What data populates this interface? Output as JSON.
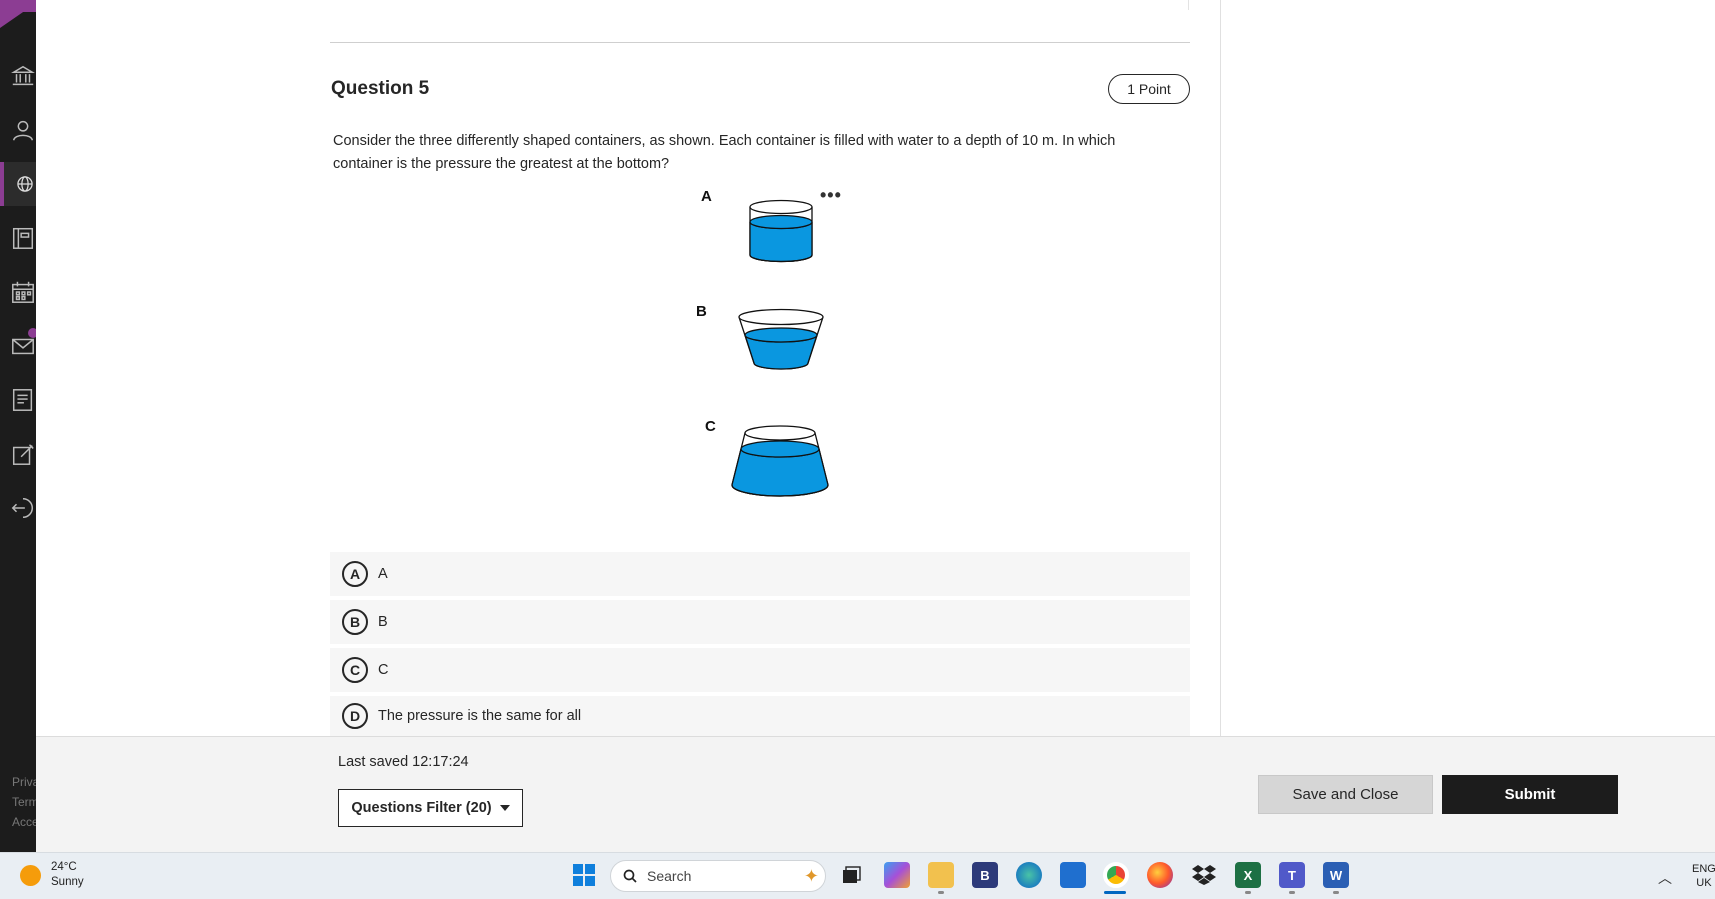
{
  "sidebar": {
    "nav": [
      {
        "name": "institution-icon"
      },
      {
        "name": "profile-icon"
      },
      {
        "name": "activity-globe-icon"
      },
      {
        "name": "courses-icon"
      },
      {
        "name": "calendar-icon"
      },
      {
        "name": "messages-icon"
      },
      {
        "name": "grades-icon"
      },
      {
        "name": "tools-icon"
      },
      {
        "name": "sign-out-icon"
      }
    ],
    "footer_links": [
      "Priva",
      "Term",
      "Acce"
    ]
  },
  "question": {
    "title": "Question 5",
    "points": "1 Point",
    "text": "Consider the three differently shaped containers, as shown. Each container is filled with water to a depth of 10 m. In which container is the pressure the greatest at the bottom?",
    "figure_labels": [
      "A",
      "B",
      "C"
    ],
    "more_menu": "•••",
    "water_color": "#0a97e0"
  },
  "options": [
    {
      "letter": "A",
      "text": "A"
    },
    {
      "letter": "B",
      "text": "B"
    },
    {
      "letter": "C",
      "text": "C"
    },
    {
      "letter": "D",
      "text": "The pressure is the same for all"
    }
  ],
  "footer": {
    "last_saved": "Last saved 12:17:24",
    "filter_label": "Questions Filter (20)",
    "save_close_label": "Save and Close",
    "submit_label": "Submit"
  },
  "taskbar": {
    "weather_temp": "24°C",
    "weather_desc": "Sunny",
    "search_placeholder": "Search",
    "lang_line1": "ENG",
    "lang_line2": "UK",
    "accent": "#0067c0"
  },
  "colors": {
    "sidebar_bg": "#1c1c1c",
    "brand_purple": "#8c3d93",
    "submit_bg": "#1c1c1c"
  }
}
